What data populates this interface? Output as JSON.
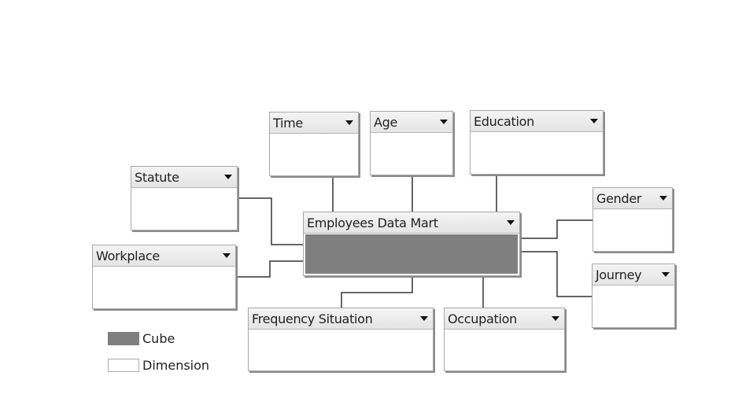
{
  "cube": {
    "title": "Employees Data Mart",
    "color": "#7f7f7f"
  },
  "dimensions": {
    "time": "Time",
    "age": "Age",
    "education": "Education",
    "statute": "Statute",
    "workplace": "Workplace",
    "gender": "Gender",
    "journey": "Journey",
    "frequency_situation": "Frequency Situation",
    "occupation": "Occupation"
  },
  "legend": {
    "cube": "Cube",
    "dimension": "Dimension"
  },
  "icons": {
    "dropdown": "chevron-down-icon"
  }
}
